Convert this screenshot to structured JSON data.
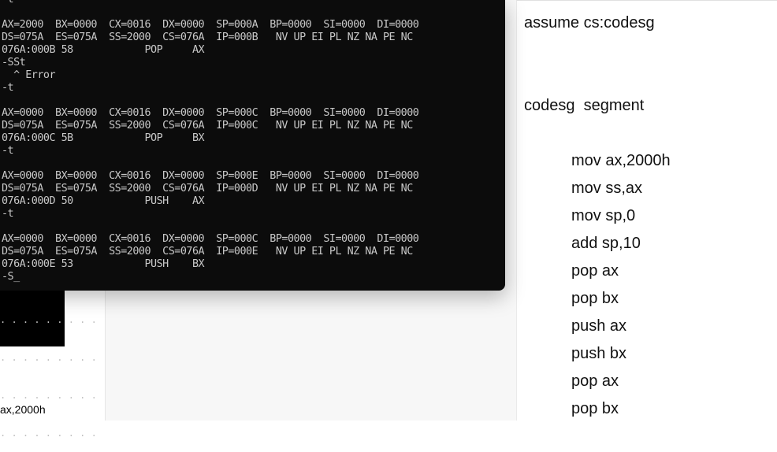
{
  "console": {
    "lines": [
      "-t",
      "",
      "AX=2000  BX=0000  CX=0016  DX=0000  SP=000A  BP=0000  SI=0000  DI=0000",
      "DS=075A  ES=075A  SS=2000  CS=076A  IP=000B   NV UP EI PL NZ NA PE NC",
      "076A:000B 58            POP     AX",
      "-SSt",
      "  ^ Error",
      "-t",
      "",
      "AX=0000  BX=0000  CX=0016  DX=0000  SP=000C  BP=0000  SI=0000  DI=0000",
      "DS=075A  ES=075A  SS=2000  CS=076A  IP=000C   NV UP EI PL NZ NA PE NC",
      "076A:000C 5B            POP     BX",
      "-t",
      "",
      "AX=0000  BX=0000  CX=0016  DX=0000  SP=000E  BP=0000  SI=0000  DI=0000",
      "DS=075A  ES=075A  SS=2000  CS=076A  IP=000D   NV UP EI PL NZ NA PE NC",
      "076A:000D 50            PUSH    AX",
      "-t",
      "",
      "AX=0000  BX=0000  CX=0016  DX=0000  SP=000C  BP=0000  SI=0000  DI=0000",
      "DS=075A  ES=075A  SS=2000  CS=076A  IP=000E   NV UP EI PL NZ NA PE NC",
      "076A:000E 53            PUSH    BX",
      "-S"
    ],
    "cursor": "_"
  },
  "background": {
    "dots": [
      ". . . . . . . . .",
      ". . . . . . . . .",
      ". . . . . . . . .",
      ". . . . . . . . ."
    ],
    "bottom_text": "ax,2000h"
  },
  "editor": {
    "line1": "assume cs:codesg",
    "line2": "codesg  segment",
    "code": [
      "mov ax,2000h",
      "mov ss,ax",
      "mov sp,0",
      "add sp,10",
      "pop ax",
      "pop bx",
      "push ax",
      "push bx",
      "pop ax",
      "pop bx"
    ]
  }
}
